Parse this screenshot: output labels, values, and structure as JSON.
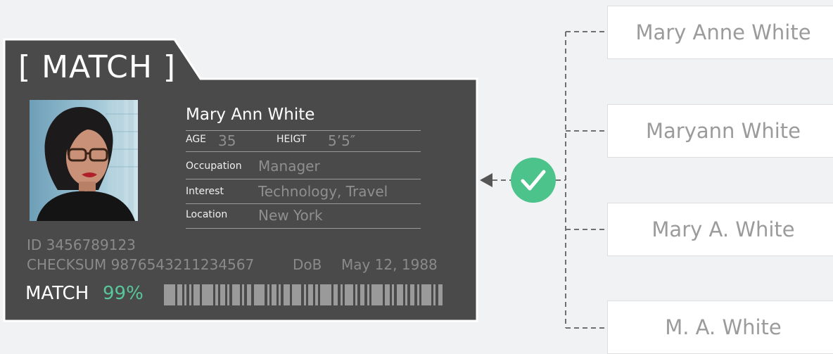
{
  "card": {
    "title": "[ MATCH ]",
    "name": "Mary Ann White",
    "age_label": "AGE",
    "age_value": "35",
    "height_label": "HEIGT",
    "height_value": "5’5″",
    "occupation_label": "Occupation",
    "occupation_value": "Manager",
    "interest_label": "Interest",
    "interest_value": "Technology, Travel",
    "location_label": "Location",
    "location_value": "New York",
    "id_line": "ID 3456789123",
    "checksum_line": "CHECKSUM 9876543211234567",
    "dob_label": "DoB",
    "dob_value": "May 12, 1988",
    "match_label": "MATCH",
    "match_percent": "99%"
  },
  "variants": [
    "Mary Anne White",
    "Maryann White",
    "Mary A. White",
    "M. A. White"
  ],
  "colors": {
    "card_bg": "#4a4a4a",
    "accent_green": "#4cc38a",
    "match_green": "#57c79b",
    "connector": "#707070"
  },
  "icons": {
    "check": "check-circle-icon",
    "arrow": "arrow-left-icon"
  }
}
